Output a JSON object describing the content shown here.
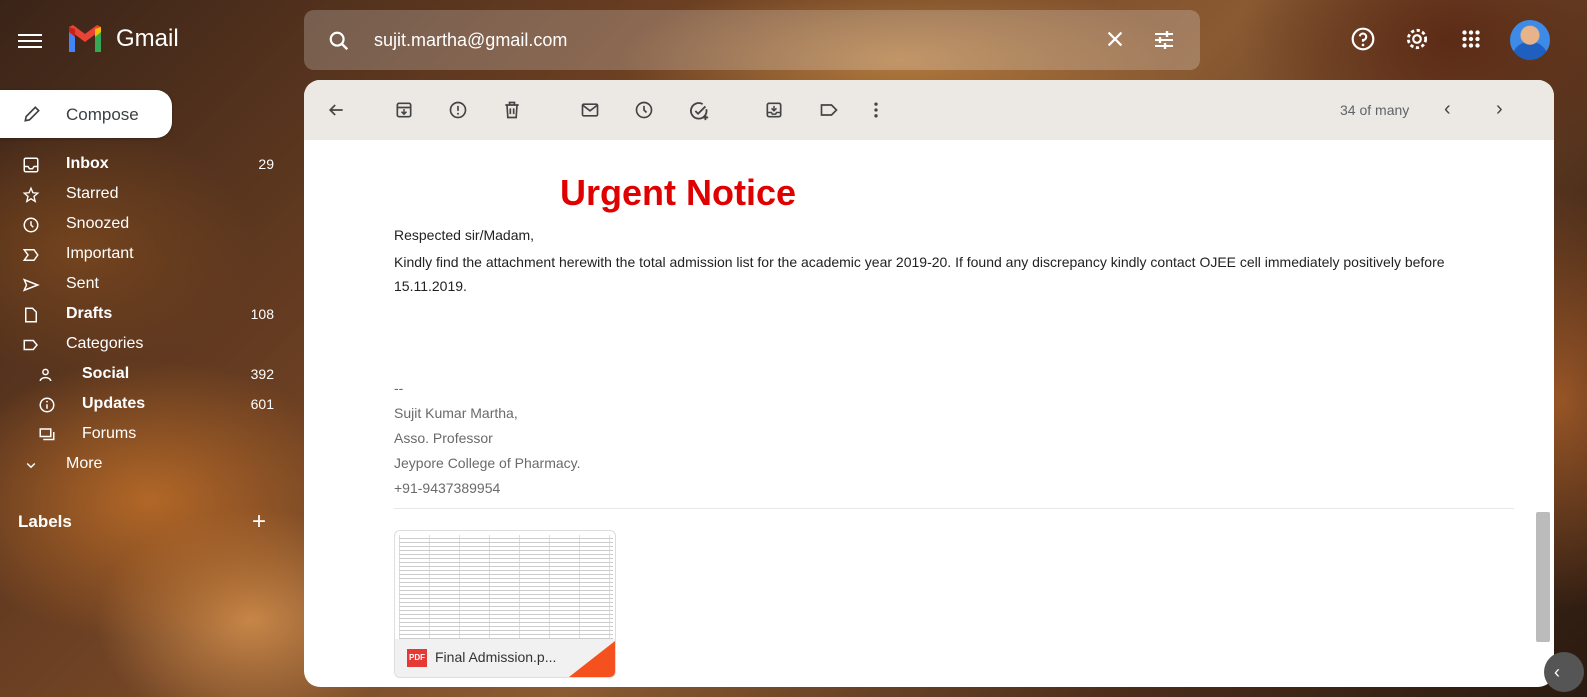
{
  "app": {
    "name": "Gmail",
    "logo_colors": {
      "red": "#EA4335",
      "blue": "#4285F4",
      "green": "#34A853",
      "yellow": "#FBBC04"
    }
  },
  "search": {
    "value": "sujit.martha@gmail.com",
    "icon": "search-icon",
    "clear_icon": "close-icon",
    "options_icon": "tune-icon"
  },
  "header_icons": [
    "help-icon",
    "settings-icon",
    "apps-icon",
    "avatar"
  ],
  "compose": {
    "label": "Compose",
    "icon": "pencil-icon"
  },
  "nav": [
    {
      "label": "Inbox",
      "count": "29",
      "bold": true,
      "icon": "inbox-icon"
    },
    {
      "label": "Starred",
      "count": "",
      "bold": false,
      "icon": "star-icon"
    },
    {
      "label": "Snoozed",
      "count": "",
      "bold": false,
      "icon": "clock-icon"
    },
    {
      "label": "Important",
      "count": "",
      "bold": false,
      "icon": "important-icon"
    },
    {
      "label": "Sent",
      "count": "",
      "bold": false,
      "icon": "send-icon"
    },
    {
      "label": "Drafts",
      "count": "108",
      "bold": true,
      "icon": "draft-icon"
    },
    {
      "label": "Categories",
      "count": "",
      "bold": false,
      "icon": "label-icon"
    },
    {
      "label": "Social",
      "count": "392",
      "bold": true,
      "icon": "people-icon"
    },
    {
      "label": "Updates",
      "count": "601",
      "bold": true,
      "icon": "info-icon"
    },
    {
      "label": "Forums",
      "count": "",
      "bold": false,
      "icon": "forum-icon"
    },
    {
      "label": "More",
      "count": "",
      "bold": false,
      "icon": "chevron-down-icon"
    }
  ],
  "labels": {
    "title": "Labels",
    "add": "+"
  },
  "toolbar": {
    "icons": [
      "back-arrow-icon",
      "archive-icon",
      "report-spam-icon",
      "delete-icon",
      "mark-unread-icon",
      "snooze-icon",
      "add-task-icon",
      "move-to-icon",
      "label-icon",
      "more-vert-icon"
    ],
    "pager": "34 of many",
    "prev": "‹",
    "next": "›"
  },
  "email": {
    "title": "Urgent Notice",
    "greeting": "Respected sir/Madam,",
    "body": "Kindly find the attachment herewith the total admission list for the academic year 2019-20. If found any discrepancy kindly contact OJEE cell immediately positively before 15.11.2019.",
    "signature": {
      "sep": "--",
      "name": "Sujit Kumar Martha,",
      "title": "Asso. Professor",
      "org": "Jeypore College of Pharmacy.",
      "phone": "+91-9437389954"
    },
    "attachment": {
      "name": "Final Admission.p...",
      "badge": "PDF",
      "badge_color": "#e53935"
    }
  }
}
